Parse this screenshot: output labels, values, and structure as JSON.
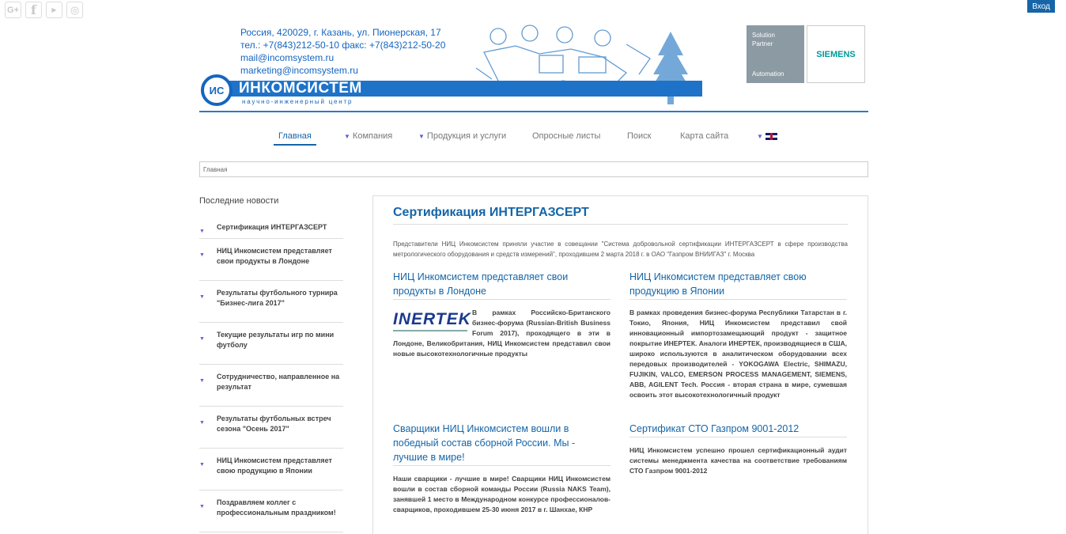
{
  "social": [
    "G+",
    "f",
    "You Tube",
    "instagram"
  ],
  "header": {
    "login_label": "Вход",
    "contacts": [
      "Россия,  420029,  г. Казань,  ул. Пионерская, 17",
      "тел.: +7(843)212-50-10  факс: +7(843)212-50-20",
      "mail@incomsystem.ru",
      "marketing@incomsystem.ru"
    ],
    "logo_text": "ИНКОМСИСТЕМ",
    "logo_sub": "научно-инженерный центр",
    "partner": {
      "line1": "Solution",
      "line2": "Partner",
      "line3": "Automation",
      "brand": "SIEMENS"
    }
  },
  "menu": [
    {
      "label": "Главная",
      "active": true,
      "caret": false
    },
    {
      "label": "Компания",
      "active": false,
      "caret": true
    },
    {
      "label": "Продукция и услуги",
      "active": false,
      "caret": true
    },
    {
      "label": "Опросные листы",
      "active": false,
      "caret": false
    },
    {
      "label": "Поиск",
      "active": false,
      "caret": false
    },
    {
      "label": "Карта сайта",
      "active": false,
      "caret": false
    }
  ],
  "breadcrumb": "Главная",
  "sidebar": {
    "title": "Последние новости",
    "items": [
      "Сертификация ИНТЕРГАЗСЕРТ",
      "НИЦ Инкомсистем представляет свои продукты в Лондоне",
      "Результаты футбольного турнира \"Бизнес-лига 2017\"",
      "Текущие результаты игр по мини футболу",
      "Сотрудничество, направленное на результат",
      "Результаты футбольных встреч сезона \"Осень 2017\"",
      "НИЦ Инкомсистем представляет свою продукцию в Японии",
      "Поздравляем коллег с профессиональным праздником!"
    ]
  },
  "main": {
    "title": "Сертификация ИНТЕРГАЗСЕРТ",
    "lead": "Представители НИЦ Инкомсистем приняли участие в совещании \"Система добровольной сертификации ИНТЕРГАЗСЕРТ в сфере производства метрологического оборудования и средств измерений\", проходившем 2 марта 2018 г. в ОАО \"Газпром ВНИИГАЗ\" г. Москва",
    "articles": [
      {
        "title": "НИЦ Инкомсистем представляет свои продукты в Лондоне",
        "logo": "INERTEK",
        "text": "В рамках Российско-Британского бизнес-форума (Russian-British Business Forum 2017), проходящего в эти в Лондоне, Великобритания, НИЦ Инкомсистем представил свои новые высокотехнологичные продукты"
      },
      {
        "title": "НИЦ Инкомсистем представляет свою продукцию в Японии",
        "text": "В рамках проведения бизнес-форума Республики Татарстан в г. Токио, Япония, НИЦ Инкомсистем представил свой инновационный импортозамещающий продукт - защитное покрытие ИНЕРТЕК. Аналоги ИНЕРТЕК, производящиеся в США, широко используются в аналитическом оборудовании всех передовых производителей - YOKOGAWA Electric, SHIMAZU, FUJIKIN, VALCO, EMERSON PROCESS MANAGEMENT, SIEMENS, ABB, AGILENT Tech. Россия - вторая страна в мире, сумевшая освоить этот высокотехнологичный продукт"
      },
      {
        "title": "Сварщики НИЦ Инкомсистем вошли в победный состав сборной России. Мы - лучшие в мире!",
        "text": "Наши сварщики - лучшие в мире! Сварщики НИЦ Инкомсистем вошли в состав сборной команды России (Russia NAKS Team), занявшей 1 место в Международном конкурсе профессионалов-сварщиков, проходившем 25-30 июня 2017 в г. Шанхае, КНР"
      },
      {
        "title": "Сертификат СТО Газпром 9001-2012",
        "text": "НИЦ Инкомсистем успешно прошел сертификационный аудит системы менеджмента качества на соответствие требованиям СТО Газпром 9001-2012"
      }
    ]
  },
  "colors": {
    "accent": "#1565a8",
    "menu_caret": "#5b64d6"
  }
}
